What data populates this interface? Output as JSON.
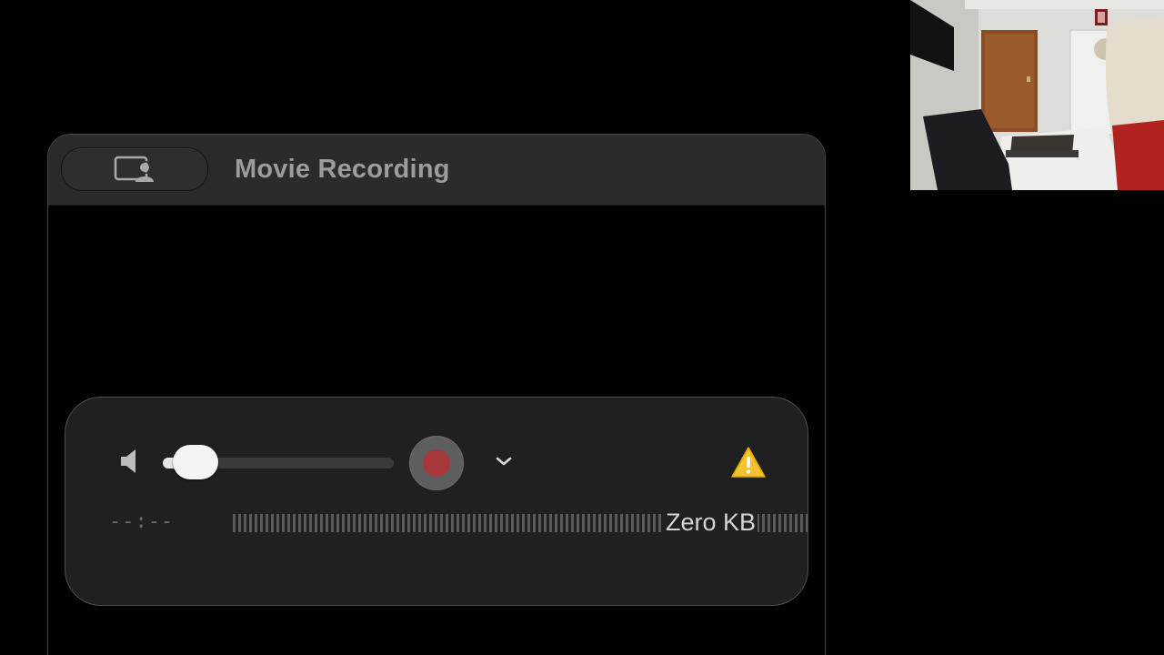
{
  "window": {
    "title": "Movie Recording",
    "screen_button_icon": "screen-with-person-icon"
  },
  "controls": {
    "speaker_icon": "speaker-icon",
    "volume_percent": 12,
    "record_icon": "record-icon",
    "record_color": "#a8383b",
    "options_icon": "chevron-down-icon",
    "warning_icon": "warning-triangle-icon",
    "warning_color": "#f2c230",
    "time": "--:--",
    "file_size": "Zero KB"
  },
  "camera_preview": {
    "icon": "camera-preview"
  }
}
